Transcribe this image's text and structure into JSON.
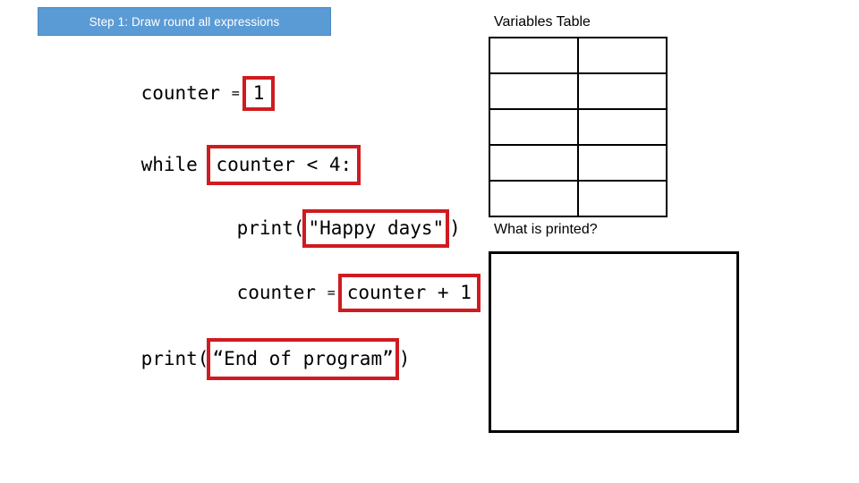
{
  "banner": {
    "label": "Step 1: Draw round all expressions",
    "bg_color": "#5B9BD5",
    "text_color": "#FFFFFF"
  },
  "highlight_color": "#CF1B20",
  "code": {
    "lines": [
      {
        "id": "assign-counter",
        "before": "counter ",
        "operator": "=",
        "boxed": "1",
        "after": ""
      },
      {
        "id": "while-loop",
        "before": "while ",
        "operator": "",
        "boxed": "counter < 4:",
        "after": ""
      },
      {
        "id": "print-happy-days",
        "before": "print(",
        "operator": "",
        "boxed": "\"Happy days\"",
        "after": ")"
      },
      {
        "id": "increment-counter",
        "before": "counter ",
        "operator": "=",
        "boxed": "counter + 1",
        "after": ""
      },
      {
        "id": "print-end-of-program",
        "before": "print(",
        "operator": "",
        "boxed": "“End of program”",
        "after": ")"
      }
    ]
  },
  "variables_table": {
    "title": "Variables Table",
    "columns": 2,
    "rows": 5,
    "cells": [
      [
        "",
        ""
      ],
      [
        "",
        ""
      ],
      [
        "",
        ""
      ],
      [
        "",
        ""
      ],
      [
        "",
        ""
      ]
    ]
  },
  "output_section": {
    "title": "What is printed?",
    "content": ""
  }
}
